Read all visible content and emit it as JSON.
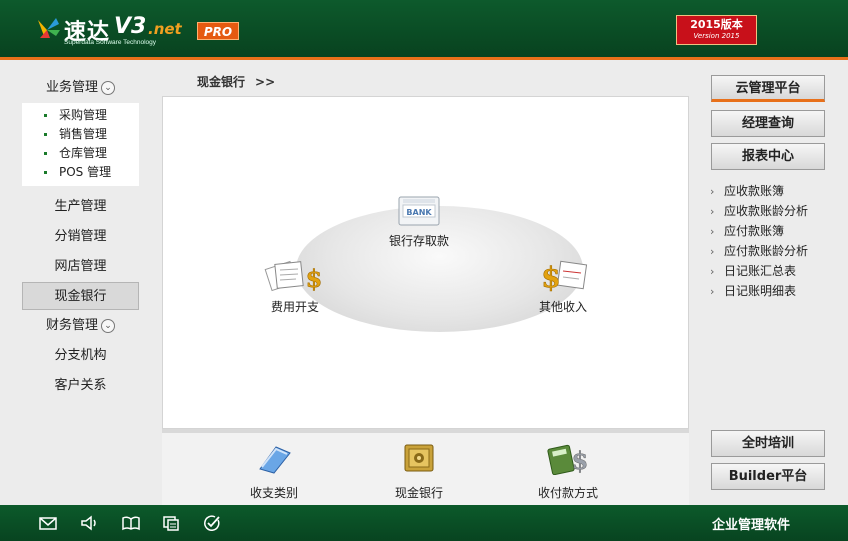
{
  "header": {
    "logo_cn": "速达",
    "logo_v3": "V3",
    "logo_net": ".net",
    "logo_sub": "Superdata Software Technology",
    "pro_badge": "PRO",
    "version_title": "2015版本",
    "version_sub": "Version 2015"
  },
  "sidebar": {
    "group_business": "业务管理",
    "business_items": [
      "采购管理",
      "销售管理",
      "仓库管理",
      "POS 管理"
    ],
    "production": "生产管理",
    "distribution": "分销管理",
    "online_store": "网店管理",
    "cash_bank": "现金银行",
    "group_finance": "财务管理",
    "branch": "分支机构",
    "crm": "客户关系",
    "group_chevron": "⌄"
  },
  "main": {
    "breadcrumb": "现金银行",
    "breadcrumb_arrow": ">>",
    "nodes": {
      "bank": "银行存取款",
      "bank_icon_text": "BANK",
      "expense": "费用开支",
      "income": "其他收入"
    },
    "bottom": {
      "category": "收支类别",
      "cash_bank": "现金银行",
      "payment_method": "收付款方式"
    }
  },
  "right": {
    "cloud": "云管理平台",
    "manager_query": "经理查询",
    "report_center": "报表中心",
    "links": [
      "应收款账簿",
      "应收款账龄分析",
      "应付款账簿",
      "应付款账龄分析",
      "日记账汇总表",
      "日记账明细表"
    ],
    "link_marker": "›",
    "training": "全时培训",
    "builder": "Builder平台"
  },
  "footer": {
    "text": "企业管理软件"
  },
  "colors": {
    "header_green": "#0d5a2c",
    "accent_orange": "#e8701a",
    "version_red": "#c8101a"
  }
}
